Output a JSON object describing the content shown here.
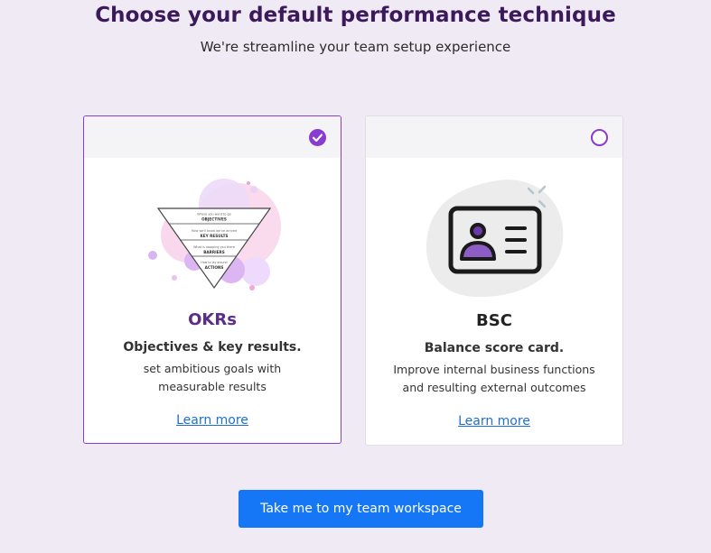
{
  "header": {
    "title": "Choose your default performance technique",
    "subtitle": "We're streamline your team setup experience"
  },
  "cards": [
    {
      "title": "OKRs",
      "subtitle": "Objectives & key results.",
      "description_line1": "set ambitious goals with",
      "description_line2": "measurable results",
      "link": "Learn more",
      "selected": true,
      "title_color": "#5b2d86",
      "pyramid_labels": {
        "objectives_hint": "Where you want to go",
        "objectives": "OBJECTIVES",
        "key_results_hint": "How we'll know we've arrived",
        "key_results": "KEY RESULTS",
        "barriers_hint": "What is stopping you there",
        "barriers": "BARRIERS",
        "actions_hint": "How to lay around",
        "actions": "ACTIONS"
      }
    },
    {
      "title": "BSC",
      "subtitle": "Balance score card.",
      "description_line1": "Improve internal business functions",
      "description_line2": "and resulting external outcomes",
      "link": "Learn more",
      "selected": false,
      "title_color": "#222222"
    }
  ],
  "cta": {
    "label": "Take me to my team workspace"
  },
  "colors": {
    "background": "#f0eaf4",
    "accent": "#8a3bd0",
    "title": "#3b1a5c",
    "link": "#1f6fd1",
    "button": "#1677f6"
  }
}
